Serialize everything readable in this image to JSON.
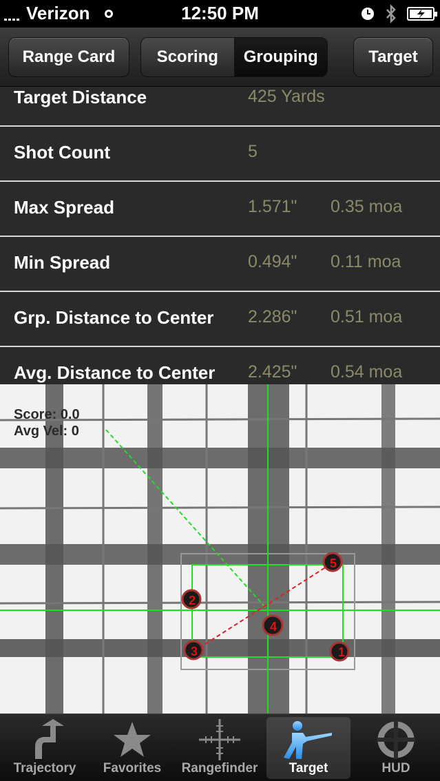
{
  "status": {
    "carrier": "Verizon",
    "time": "12:50 PM"
  },
  "nav": {
    "back_label": "Range Card",
    "segments": [
      "Scoring",
      "Grouping"
    ],
    "active_segment": "Grouping",
    "right_label": "Target"
  },
  "table": {
    "rows": [
      {
        "label": "Target Distance",
        "value": "425 Yards",
        "moa": ""
      },
      {
        "label": "Shot Count",
        "value": "5",
        "moa": ""
      },
      {
        "label": "Max Spread",
        "value": "1.571\"",
        "moa": "0.35 moa"
      },
      {
        "label": "Min Spread",
        "value": "0.494\"",
        "moa": "0.11 moa"
      },
      {
        "label": "Grp. Distance to Center",
        "value": "2.286\"",
        "moa": "0.51 moa"
      },
      {
        "label": "Avg. Distance to Center",
        "value": "2.425\"",
        "moa": "0.54 moa"
      }
    ]
  },
  "target": {
    "score_text": "Score: 0.0",
    "avg_vel_text": "Avg Vel: 0",
    "shots": [
      "1",
      "2",
      "3",
      "4",
      "5"
    ]
  },
  "tabs": [
    {
      "label": "Trajectory",
      "icon": "trajectory-icon"
    },
    {
      "label": "Favorites",
      "icon": "star-icon"
    },
    {
      "label": "Rangefinder",
      "icon": "crosshair-icon"
    },
    {
      "label": "Target",
      "icon": "shooter-icon"
    },
    {
      "label": "HUD",
      "icon": "hud-icon"
    }
  ],
  "active_tab": "Target",
  "colors": {
    "value_text": "#8b8a68",
    "crosshair": "#22dd22",
    "shot_marker": "#cc1111"
  }
}
